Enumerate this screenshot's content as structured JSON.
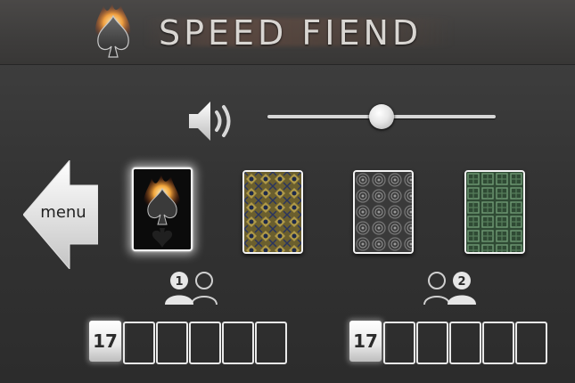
{
  "header": {
    "title": "SPEED FIEND",
    "logo_icon": "flaming-spade-icon"
  },
  "sound": {
    "icon": "speaker-icon",
    "volume_percent": 50
  },
  "menu": {
    "label": "menu",
    "icon": "left-arrow-icon"
  },
  "card_backs": [
    {
      "name": "flaming-spade",
      "selected": true
    },
    {
      "name": "gold-pattern",
      "selected": false
    },
    {
      "name": "gray-swirl",
      "selected": false
    },
    {
      "name": "green-celtic",
      "selected": false
    }
  ],
  "players": [
    {
      "number": "1",
      "score": "17",
      "slots": 5
    },
    {
      "number": "2",
      "score": "17",
      "slots": 5
    }
  ],
  "colors": {
    "background": "#333333",
    "header": "#444342",
    "slot_border": "#e9e9e9"
  }
}
